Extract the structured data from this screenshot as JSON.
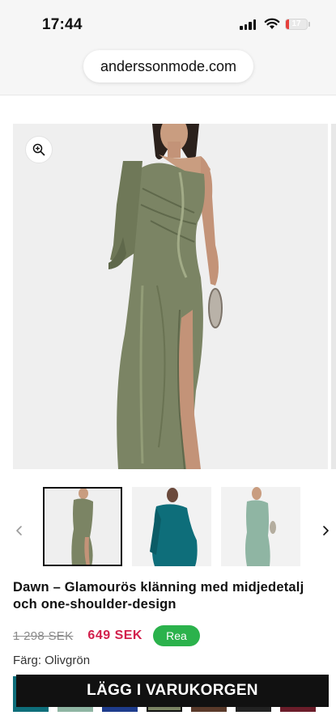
{
  "status": {
    "time": "17:44",
    "battery": "17",
    "battery_level": 0.17
  },
  "browser": {
    "url": "anderssonmode.com"
  },
  "product": {
    "title": "Dawn – Glamourös klänning med midjedetalj och one-shoulder-design",
    "old_price": "1 298 SEK",
    "new_price": "649 SEK",
    "badge": "Rea",
    "color_label": "Färg: Olivgrön",
    "cart_button": "LÄGG I VARUKORGEN"
  },
  "gallery": {
    "thumbnails": [
      "olive-dress",
      "teal-dress",
      "mint-dress"
    ],
    "active_index": 0
  },
  "colors": {
    "sale_price": "#d21f4c",
    "badge_bg": "#2bb24c",
    "button_bg": "#111111",
    "olive": "#7b8464",
    "teal": "#0e6e7a",
    "mint": "#8fb5a3"
  }
}
